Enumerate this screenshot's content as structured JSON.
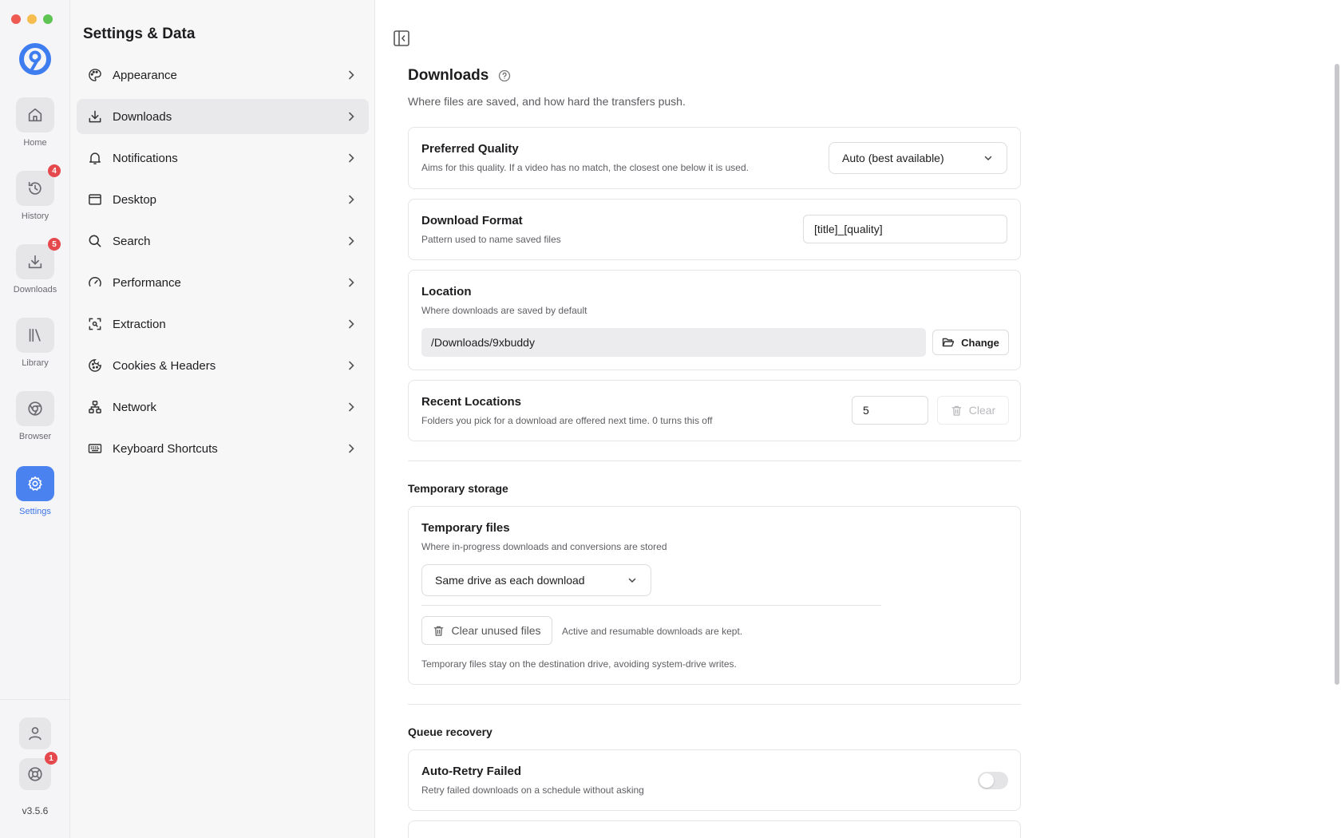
{
  "rail": {
    "items": [
      {
        "label": "Home",
        "badge": ""
      },
      {
        "label": "History",
        "badge": "4"
      },
      {
        "label": "Downloads",
        "badge": "5"
      },
      {
        "label": "Library",
        "badge": ""
      },
      {
        "label": "Browser",
        "badge": ""
      },
      {
        "label": "Settings",
        "badge": ""
      }
    ],
    "support_badge": "1",
    "version": "v3.5.6"
  },
  "nav": {
    "title": "Settings & Data",
    "items": [
      {
        "label": "Appearance"
      },
      {
        "label": "Downloads"
      },
      {
        "label": "Notifications"
      },
      {
        "label": "Desktop"
      },
      {
        "label": "Search"
      },
      {
        "label": "Performance"
      },
      {
        "label": "Extraction"
      },
      {
        "label": "Cookies & Headers"
      },
      {
        "label": "Network"
      },
      {
        "label": "Keyboard Shortcuts"
      }
    ]
  },
  "page": {
    "title": "Downloads",
    "subtitle": "Where files are saved, and how hard the transfers push."
  },
  "quality": {
    "title": "Preferred Quality",
    "desc": "Aims for this quality. If a video has no match, the closest one below it is used.",
    "value": "Auto (best available)"
  },
  "format": {
    "title": "Download Format",
    "desc": "Pattern used to name saved files",
    "value": "[title]_[quality]"
  },
  "location": {
    "title": "Location",
    "desc": "Where downloads are saved by default",
    "path": "/Downloads/9xbuddy",
    "change_label": "Change"
  },
  "recent": {
    "title": "Recent Locations",
    "desc": "Folders you pick for a download are offered next time. 0 turns this off",
    "value": "5",
    "clear_label": "Clear"
  },
  "temp": {
    "section": "Temporary storage",
    "title": "Temporary files",
    "desc": "Where in-progress downloads and conversions are stored",
    "select_value": "Same drive as each download",
    "clear_label": "Clear unused files",
    "clear_note": "Active and resumable downloads are kept.",
    "footer": "Temporary files stay on the destination drive, avoiding system-drive writes."
  },
  "queue": {
    "section": "Queue recovery",
    "title": "Auto-Retry Failed",
    "desc": "Retry failed downloads on a schedule without asking",
    "enabled": false
  },
  "colors": {
    "accent": "#4a82f0",
    "badge": "#e5484d",
    "traffic_red": "#ee5a52",
    "traffic_yellow": "#f5bd4f",
    "traffic_green": "#5fc454"
  }
}
